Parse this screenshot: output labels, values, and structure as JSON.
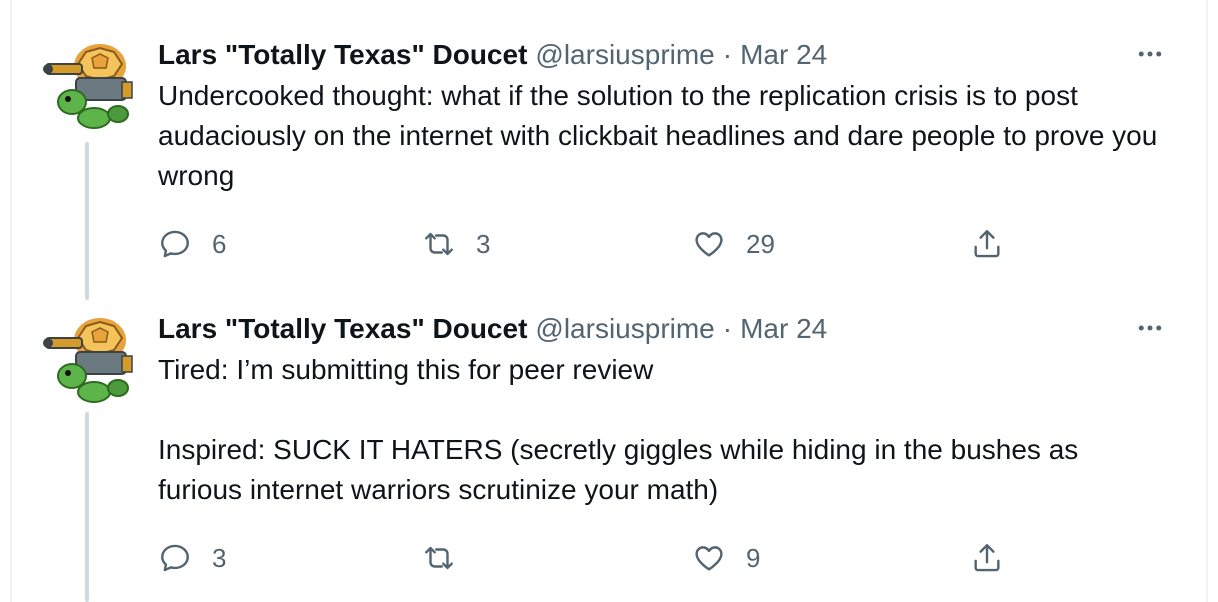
{
  "tweets": [
    {
      "author_name": "Lars \"Totally Texas\" Doucet",
      "handle": "@larsiusprime",
      "separator": "·",
      "date": "Mar 24",
      "paragraphs": [
        "Undercooked thought: what if the solution to the replication crisis is to post audaciously on the internet with clickbait headlines and dare people to prove you wrong"
      ],
      "replies": "6",
      "retweets": "3",
      "likes": "29"
    },
    {
      "author_name": "Lars \"Totally Texas\" Doucet",
      "handle": "@larsiusprime",
      "separator": "·",
      "date": "Mar 24",
      "paragraphs": [
        "Tired: I’m submitting this for peer review",
        "Inspired: SUCK IT HATERS (secretly giggles while hiding in the bushes as furious internet warriors scrutinize your math)"
      ],
      "replies": "3",
      "retweets": "",
      "likes": "9"
    }
  ],
  "icons": {
    "more": "more-horizontal-icon",
    "reply": "reply-icon",
    "retweet": "retweet-icon",
    "like": "heart-icon",
    "share": "share-icon",
    "avatar": "turtle-tank-avatar"
  },
  "colors": {
    "text_primary": "#0f1419",
    "text_secondary": "#536471",
    "thread_line": "#cfd9de"
  }
}
